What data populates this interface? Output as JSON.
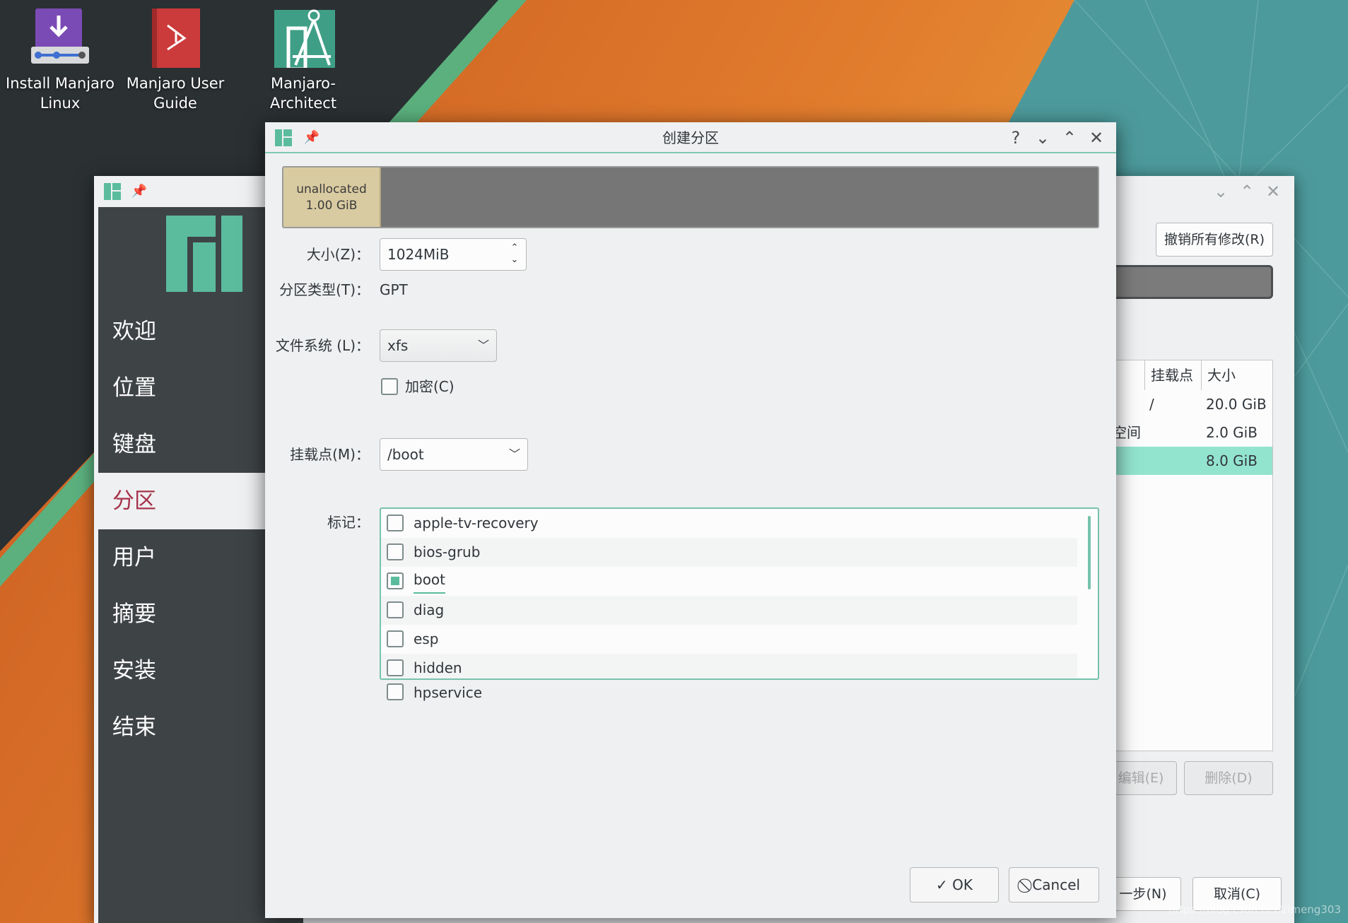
{
  "desktop": {
    "icons": [
      {
        "label": "Install Manjaro Linux",
        "icon": "download-install-icon"
      },
      {
        "label": "Manjaro User Guide",
        "icon": "pdf-document-icon"
      },
      {
        "label": "Manjaro-Architect",
        "icon": "architect-compass-icon"
      }
    ]
  },
  "installer": {
    "sidebar": {
      "items": [
        {
          "label": "欢迎"
        },
        {
          "label": "位置"
        },
        {
          "label": "键盘"
        },
        {
          "label": "分区",
          "active": true
        },
        {
          "label": "用户"
        },
        {
          "label": "摘要"
        },
        {
          "label": "安装"
        },
        {
          "label": "结束"
        }
      ]
    },
    "revert_button": "撤销所有修改(R)",
    "table": {
      "headers": {
        "mount": "挂载点",
        "size": "大小"
      },
      "rows": [
        {
          "mount": "/",
          "size": "20.0 GiB",
          "name": ""
        },
        {
          "mount": "",
          "size": "2.0 GiB",
          "name": "空间"
        },
        {
          "mount": "",
          "size": "8.0 GiB",
          "name": "",
          "selected": true
        }
      ]
    },
    "edit_button": "编辑(E)",
    "delete_button": "删除(D)",
    "next_button": "一步(N)",
    "cancel_button": "取消(C)"
  },
  "dialog": {
    "title": "创建分区",
    "help": "?",
    "allocation": {
      "label": "unallocated",
      "size": "1.00 GiB"
    },
    "size_label": "大小(Z)：",
    "size_value": "1024MiB",
    "type_label": "分区类型(T)：",
    "type_value": "GPT",
    "fs_label": "文件系统 (L)：",
    "fs_value": "xfs",
    "encrypt_label": "加密(C)",
    "encrypt_checked": false,
    "mount_label": "挂载点(M)：",
    "mount_value": "/boot",
    "flags_label": "标记：",
    "flags": [
      {
        "label": "apple-tv-recovery",
        "checked": false
      },
      {
        "label": "bios-grub",
        "checked": false
      },
      {
        "label": "boot",
        "checked": true
      },
      {
        "label": "diag",
        "checked": false
      },
      {
        "label": "esp",
        "checked": false
      },
      {
        "label": "hidden",
        "checked": false
      },
      {
        "label": "hpservice",
        "checked": false
      }
    ],
    "ok_button": "OK",
    "cancel_button": "Cancel"
  },
  "watermark": "https://blog.csdn.net/zimeng303",
  "colors": {
    "accent": "#5bbc9d",
    "active_text": "#a6334d",
    "selected_row": "#93e4cf"
  }
}
